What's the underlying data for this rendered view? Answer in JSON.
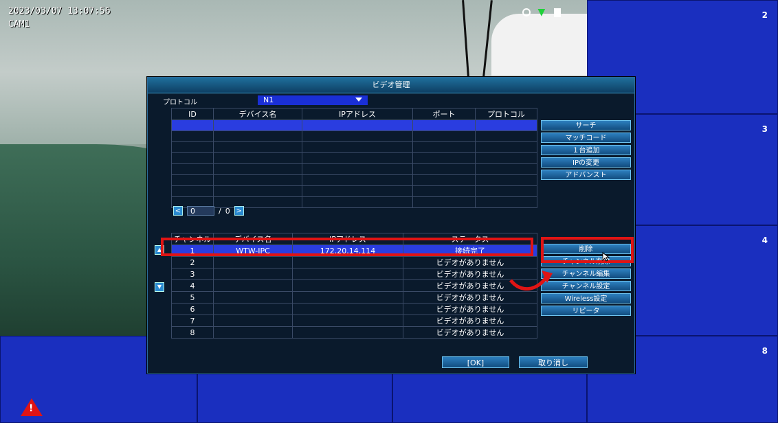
{
  "osd": {
    "datetime": "2023/03/07 13:07:56",
    "cam_label": "CAM1"
  },
  "grid_numbers": {
    "c2": "2",
    "c3": "3",
    "c4": "4",
    "c8": "8"
  },
  "dialog": {
    "title": "ビデオ管理",
    "protocol_label": "プロトコル",
    "protocol_value": "N1",
    "search_table": {
      "headers": [
        "ID",
        "デバイス名",
        "IPアドレス",
        "ポート",
        "プロトコル"
      ],
      "rows": 8
    },
    "pager": {
      "prev": "<",
      "current": "0",
      "sep": "/",
      "total": "0",
      "next": ">"
    },
    "side_buttons": [
      "サーチ",
      "マッチコード",
      "１台追加",
      "IPの変更",
      "アドバンスト"
    ],
    "channel_table": {
      "headers": [
        "チャンネル",
        "デバイス名",
        "IPアドレス",
        "ステータス"
      ],
      "rows": [
        {
          "ch": "1",
          "name": "WTW-IPC",
          "ip": "172.20.14.114",
          "status": "接続完了"
        },
        {
          "ch": "2",
          "name": "",
          "ip": "",
          "status": "ビデオがありません"
        },
        {
          "ch": "3",
          "name": "",
          "ip": "",
          "status": "ビデオがありません"
        },
        {
          "ch": "4",
          "name": "",
          "ip": "",
          "status": "ビデオがありません"
        },
        {
          "ch": "5",
          "name": "",
          "ip": "",
          "status": "ビデオがありません"
        },
        {
          "ch": "6",
          "name": "",
          "ip": "",
          "status": "ビデオがありません"
        },
        {
          "ch": "7",
          "name": "",
          "ip": "",
          "status": "ビデオがありません"
        },
        {
          "ch": "8",
          "name": "",
          "ip": "",
          "status": "ビデオがありません"
        }
      ]
    },
    "channel_buttons": [
      "削除",
      "チャンネル削除",
      "チャンネル編集",
      "チャンネル設定",
      "Wireless設定",
      "リピータ"
    ],
    "ok_label": "[OK]",
    "cancel_label": "取り消し"
  },
  "colors": {
    "highlight": "#e01414",
    "selection": "#2a3de0",
    "background": "#1a2fbf"
  },
  "icons": [
    "clock-icon",
    "wifi-icon",
    "record-icon",
    "warning-icon",
    "arrow-up-icon",
    "arrow-down-icon",
    "cursor-icon"
  ]
}
